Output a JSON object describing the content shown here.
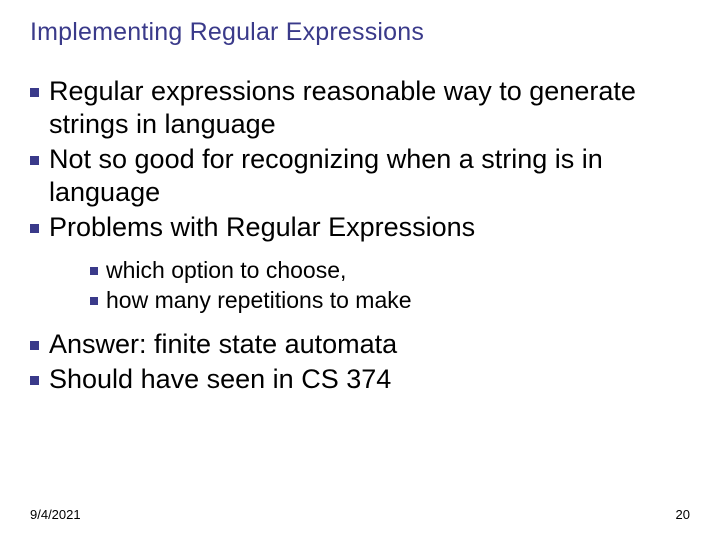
{
  "title": "Implementing Regular Expressions",
  "bullets": {
    "b1": "Regular expressions reasonable way to generate strings in language",
    "b2": "Not so good for recognizing when a string is in language",
    "b3": "Problems with Regular Expressions",
    "s1": "which option to choose,",
    "s2": " how many repetitions to make",
    "b4": "Answer: finite state automata",
    "b5": "Should have seen in CS 374"
  },
  "footer": {
    "date": "9/4/2021",
    "page": "20"
  }
}
